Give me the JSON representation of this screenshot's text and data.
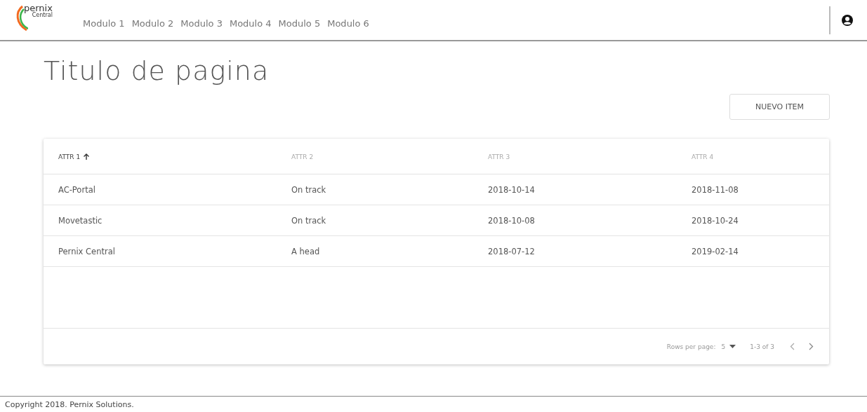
{
  "logo": {
    "name": "pernix",
    "sub": "Central"
  },
  "nav": [
    {
      "label": "Modulo 1"
    },
    {
      "label": "Modulo 2"
    },
    {
      "label": "Modulo 3"
    },
    {
      "label": "Modulo 4"
    },
    {
      "label": "Modulo 5"
    },
    {
      "label": "Modulo 6"
    }
  ],
  "page_title": "Titulo de pagina",
  "new_button": "NUEVO ITEM",
  "table": {
    "columns": [
      {
        "label": "ATTR 1",
        "sorted": true
      },
      {
        "label": "ATTR 2",
        "sorted": false
      },
      {
        "label": "ATTR 3",
        "sorted": false
      },
      {
        "label": "ATTR 4",
        "sorted": false
      }
    ],
    "rows": [
      [
        "AC-Portal",
        "On track",
        "2018-10-14",
        "2018-11-08"
      ],
      [
        "Movetastic",
        "On track",
        "2018-10-08",
        "2018-10-24"
      ],
      [
        "Pernix Central",
        "A head",
        "2018-07-12",
        "2019-02-14"
      ]
    ],
    "pagination": {
      "rows_label": "Rows per page:",
      "rows_value": "5",
      "range": "1-3 of 3"
    }
  },
  "footer": "Copyright 2018. Pernix Solutions."
}
